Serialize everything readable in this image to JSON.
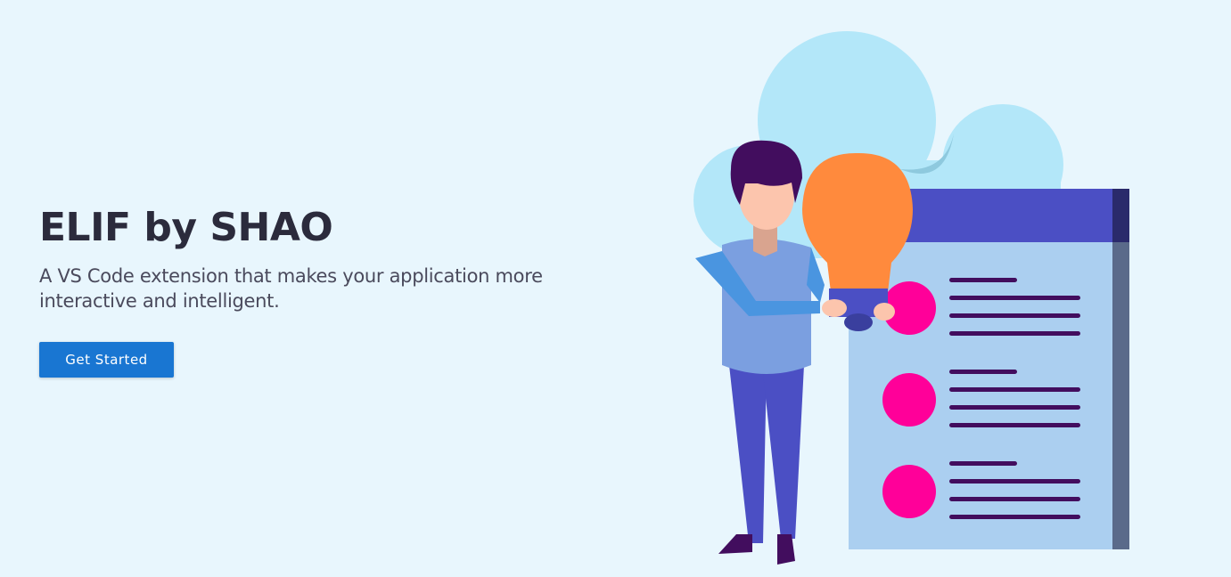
{
  "hero": {
    "title": "ELIF by SHAO",
    "subtitle": "A VS Code extension that makes your application more interactive and intelligent.",
    "cta_label": "Get Started"
  },
  "colors": {
    "background": "#e8f6fd",
    "title": "#2b2b3c",
    "subtitle": "#4a4a5c",
    "button": "#1976d2",
    "cloud": "#b3e7f9",
    "board": "#4b4fc4",
    "board_page": "#abcff0",
    "bullet": "#ff0099",
    "line": "#420d5e",
    "bulb": "#ff8a3d",
    "shirt": "#7b9fe0",
    "pants": "#4b4fc4",
    "hair": "#420d5e",
    "skin": "#fcc5ad"
  },
  "illustration": {
    "icon": "person-holding-lightbulb-illustration"
  }
}
